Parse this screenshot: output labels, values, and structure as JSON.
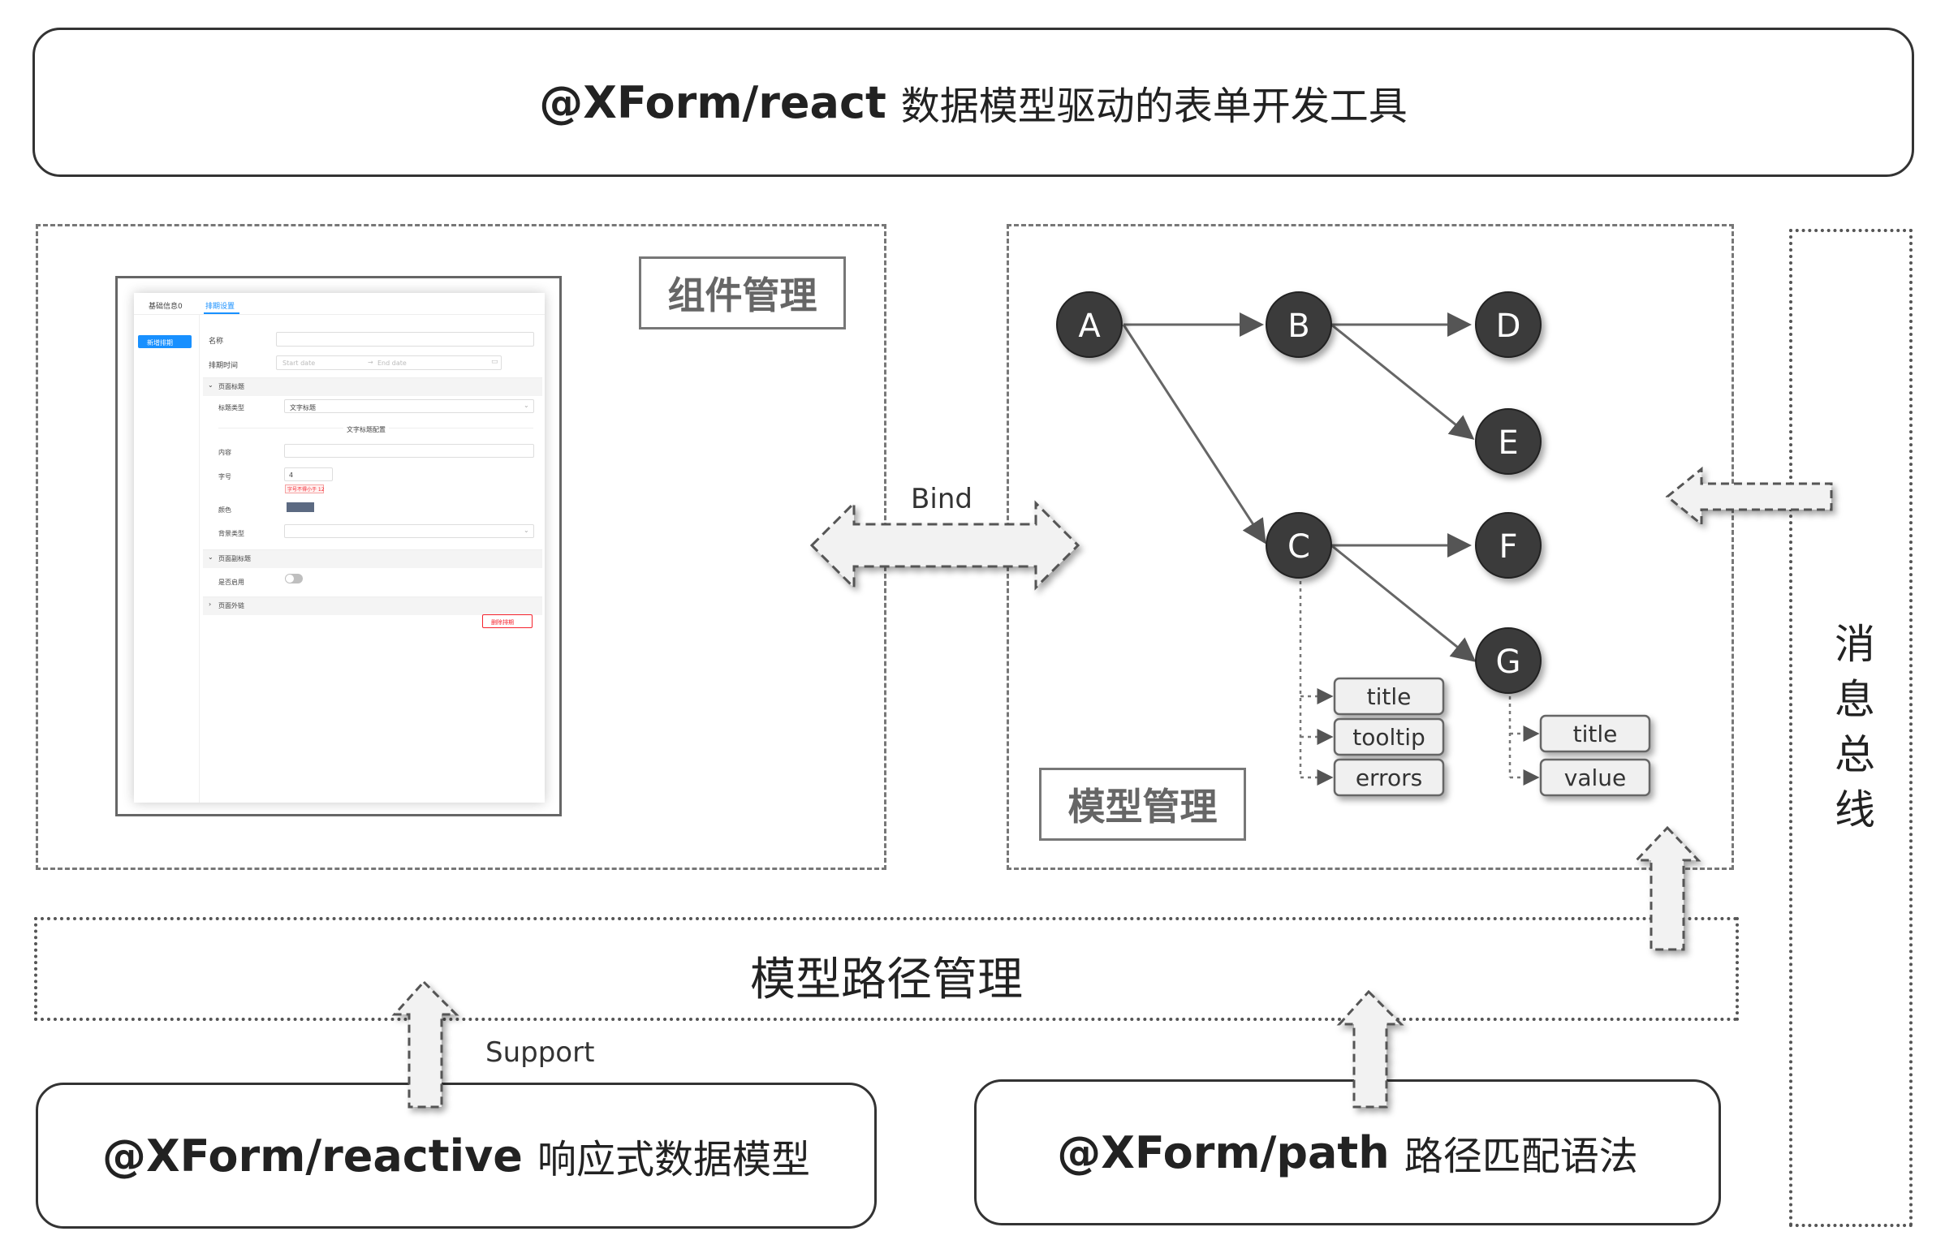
{
  "header": {
    "title_code": "@XForm/react",
    "title_text": "数据模型驱动的表单开发工具"
  },
  "component_panel": {
    "label": "组件管理",
    "form": {
      "tabs": [
        "基础信息0",
        "排期设置"
      ],
      "add_button": "新增排期",
      "fields": {
        "name_label": "名称",
        "time_label": "排期时间",
        "start_placeholder": "Start date",
        "end_placeholder": "End date",
        "section_title": "页面标题",
        "title_type_label": "标题类型",
        "title_type_value": "文字标题",
        "text_config": "文字标题配置",
        "content_label": "内容",
        "size_label": "字号",
        "size_value": "4",
        "size_error": "字号不得小于 12",
        "color_label": "颜色",
        "bg_type_label": "背景类型",
        "subtitle_section": "页面副标题",
        "enable_label": "是否启用",
        "outer_section": "页面外链",
        "delete_button": "删除排期"
      }
    }
  },
  "bind_label": "Bind",
  "model_panel": {
    "label": "模型管理",
    "nodes": [
      "A",
      "B",
      "C",
      "D",
      "E",
      "F",
      "G"
    ],
    "c_props": [
      "title",
      "tooltip",
      "errors"
    ],
    "g_props": [
      "title",
      "value"
    ]
  },
  "path_bar": {
    "label": "模型路径管理"
  },
  "support_label": "Support",
  "reactive_box": {
    "code": "@XForm/reactive",
    "text": "响应式数据模型"
  },
  "path_box": {
    "code": "@XForm/path",
    "text": "路径匹配语法"
  },
  "message_bus": {
    "chars": [
      "消",
      "息",
      "总",
      "线"
    ]
  },
  "colors": {
    "node_fill": "#3b3b3b",
    "node_text": "#ffffff",
    "accent_blue": "#1890ff",
    "arrow_fill": "#f2f2f2"
  }
}
